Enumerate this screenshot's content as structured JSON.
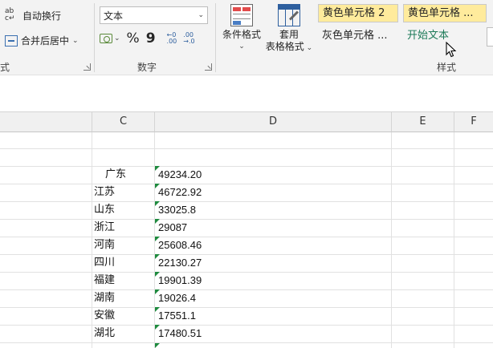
{
  "ribbon": {
    "alignment": {
      "wrap_text": "自动换行",
      "merge_center": "合并后居中",
      "group_label_partial": "式"
    },
    "number": {
      "format_value": "文本",
      "percent": "%",
      "comma": "9",
      "increase_decimal_top": "←0",
      "increase_decimal_bottom": ".00",
      "decrease_decimal_top": ".00",
      "decrease_decimal_bottom": "→.0",
      "group_label": "数字"
    },
    "styles": {
      "conditional_format": "条件格式",
      "table_format_line1": "套用",
      "table_format_line2": "表格格式",
      "cell_styles": [
        "黄色单元格 2",
        "黄色单元格 ...",
        "灰色单元格 ...",
        "开始文本"
      ],
      "group_label": "样式"
    },
    "colors": {
      "yellow_style": "#ffeb9c",
      "start_text": "#1d7a58",
      "green_triangle": "#1e8a3e"
    }
  },
  "sheet": {
    "columns": [
      "C",
      "D",
      "E",
      "F"
    ],
    "rows": [
      {
        "province": "广东",
        "value": "49234.20"
      },
      {
        "province": "江苏",
        "value": "46722.92"
      },
      {
        "province": "山东",
        "value": "33025.8"
      },
      {
        "province": "浙江",
        "value": "29087"
      },
      {
        "province": "河南",
        "value": "25608.46"
      },
      {
        "province": "四川",
        "value": "22130.27"
      },
      {
        "province": "福建",
        "value": "19901.39"
      },
      {
        "province": "湖南",
        "value": "19026.4"
      },
      {
        "province": "安徽",
        "value": "17551.1"
      },
      {
        "province": "湖北",
        "value": "17480.51"
      }
    ]
  }
}
